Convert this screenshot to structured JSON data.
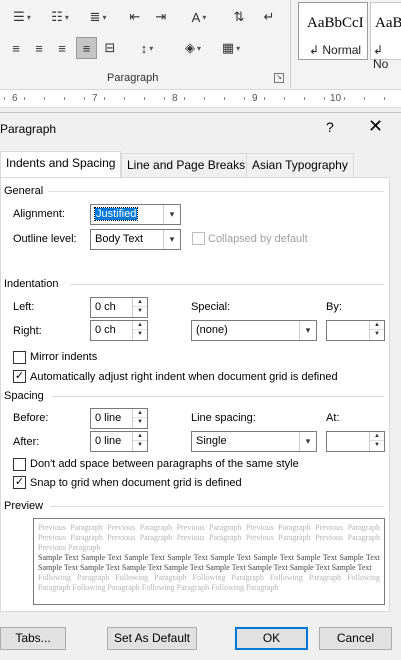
{
  "ribbon": {
    "group_label": "Paragraph",
    "styles": [
      {
        "sample": "AaBbCcI",
        "name": "Normal"
      },
      {
        "sample": "AaB",
        "name": "No"
      }
    ]
  },
  "ruler": {
    "numbers": [
      "6",
      "7",
      "8",
      "9",
      "10"
    ]
  },
  "dialog": {
    "title": "Paragraph",
    "help": "?",
    "close": "✕",
    "tabs": [
      "Indents and Spacing",
      "Line and Page Breaks",
      "Asian Typography"
    ],
    "general": {
      "heading": "General",
      "alignment_label": "Alignment:",
      "alignment_value": "Justified",
      "outline_label": "Outline level:",
      "outline_value": "Body Text",
      "collapsed_label": "Collapsed by default"
    },
    "indentation": {
      "heading": "Indentation",
      "left_label": "Left:",
      "left_value": "0 ch",
      "right_label": "Right:",
      "right_value": "0 ch",
      "special_label": "Special:",
      "special_value": "(none)",
      "by_label": "By:",
      "by_value": "",
      "mirror_label": "Mirror indents",
      "auto_adjust_label": "Automatically adjust right indent when document grid is defined"
    },
    "spacing": {
      "heading": "Spacing",
      "before_label": "Before:",
      "before_value": "0 line",
      "after_label": "After:",
      "after_value": "0 line",
      "line_spacing_label": "Line spacing:",
      "line_spacing_value": "Single",
      "at_label": "At:",
      "at_value": "",
      "no_space_label": "Don't add space between paragraphs of the same style",
      "snap_label": "Snap to grid when document grid is defined"
    },
    "preview": {
      "heading": "Preview",
      "prev_text": "Previous Paragraph Previous Paragraph Previous Paragraph Previous Paragraph Previous Paragraph Previous Paragraph Previous Paragraph Previous Paragraph Previous Paragraph Previous Paragraph Previous Paragraph",
      "sample_text": "Sample Text Sample Text Sample Text Sample Text Sample Text Sample Text Sample Text Sample Text Sample Text Sample Text Sample Text Sample Text Sample Text Sample Text Sample Text Sample Text",
      "next_text": "Following Paragraph Following Paragraph Following Paragraph Following Paragraph Following Paragraph Following Paragraph Following Paragraph Following Paragraph"
    },
    "buttons": {
      "tabs": "Tabs...",
      "set_default": "Set As Default",
      "ok": "OK",
      "cancel": "Cancel"
    }
  }
}
